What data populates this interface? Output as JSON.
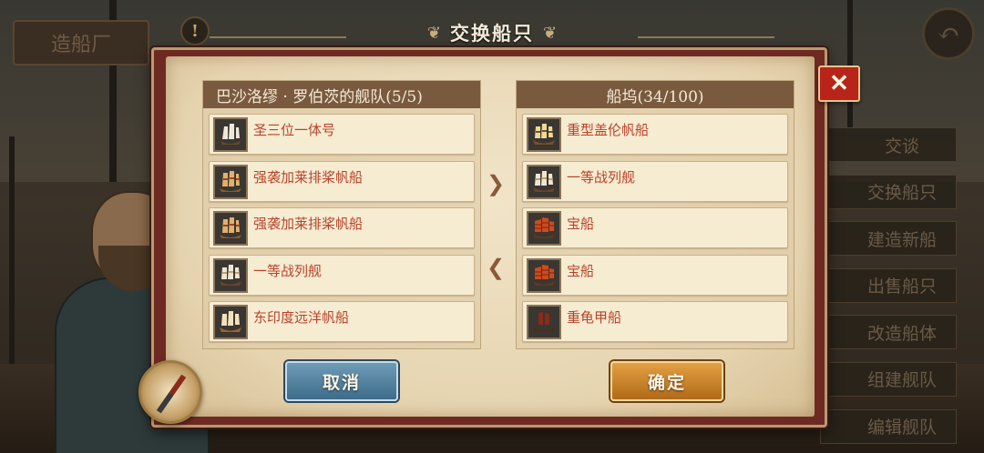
{
  "header": {
    "title": "交换船只",
    "top_left_label": "造船厂",
    "alert_label": "!",
    "back_label": "↶"
  },
  "side_menu": {
    "items": [
      "交谈",
      "交换船只",
      "建造新船",
      "出售船只",
      "改造船体",
      "组建舰队",
      "编辑舰队"
    ]
  },
  "fleet_panel": {
    "title": "巴沙洛缪 · 罗伯茨的舰队(5/5)",
    "ships": [
      {
        "name": "圣三位一体号",
        "icon": "galleon-white-sail-icon"
      },
      {
        "name": "强袭加莱排桨帆船",
        "icon": "galley-ship-icon"
      },
      {
        "name": "强袭加莱排桨帆船",
        "icon": "galley-ship-icon"
      },
      {
        "name": "一等战列舰",
        "icon": "warship-icon"
      },
      {
        "name": "东印度远洋帆船",
        "icon": "east-indiaman-icon"
      }
    ]
  },
  "dock_panel": {
    "title": "船坞(34/100)",
    "ships": [
      {
        "name": "重型盖伦帆船",
        "icon": "heavy-galleon-icon"
      },
      {
        "name": "一等战列舰",
        "icon": "warship-icon"
      },
      {
        "name": "宝船",
        "icon": "junk-red-sail-icon"
      },
      {
        "name": "宝船",
        "icon": "junk-red-sail-icon"
      },
      {
        "name": "重龟甲船",
        "icon": "turtle-ship-icon"
      }
    ]
  },
  "buttons": {
    "cancel": "取消",
    "confirm": "确定",
    "close": "✕",
    "arrow_right": "❯",
    "arrow_left": "❮"
  },
  "colors": {
    "ship_name": "#b8432a",
    "panel_header": "#7a5a3e",
    "dialog_frame": "#6e2a22",
    "cancel_button": "#4a7a98",
    "confirm_button": "#c98228",
    "close_button": "#b8231a"
  }
}
